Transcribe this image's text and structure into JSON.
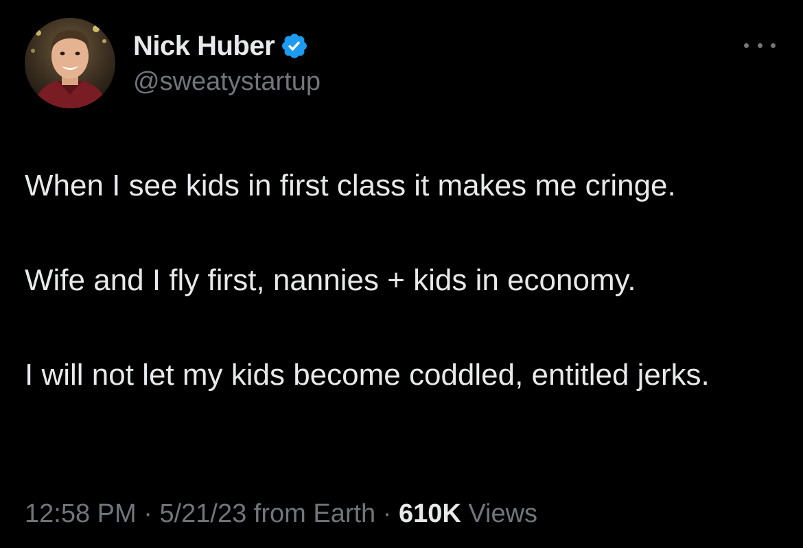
{
  "author": {
    "display_name": "Nick Huber",
    "handle": "@sweatystartup",
    "verified": true,
    "verified_color": "#1d9bf0"
  },
  "tweet": {
    "paragraphs": [
      "When I see kids in first class it makes me cringe.",
      "Wife and I fly first, nannies + kids in economy.",
      "I will not let my kids become coddled, entitled jerks."
    ]
  },
  "meta": {
    "time": "12:58 PM",
    "separator1": " · ",
    "date": "5/21/23",
    "source": " from Earth",
    "separator2": " · ",
    "views_count": "610K",
    "views_label": " Views"
  },
  "icons": {
    "more": "more-options-icon",
    "verified": "verified-badge-icon"
  },
  "colors": {
    "background": "#000000",
    "text_primary": "#e7e9ea",
    "text_secondary": "#71767b",
    "accent": "#1d9bf0"
  }
}
